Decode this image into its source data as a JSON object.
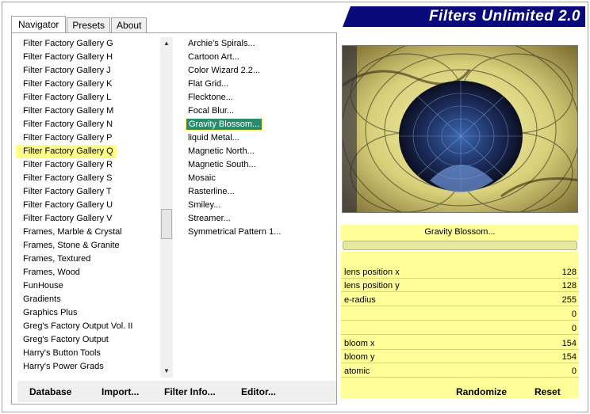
{
  "banner": {
    "title": "Filters Unlimited 2.0"
  },
  "tabs": [
    {
      "label": "Navigator"
    },
    {
      "label": "Presets"
    },
    {
      "label": "About"
    }
  ],
  "categories": {
    "items": [
      "Filter Factory Gallery G",
      "Filter Factory Gallery H",
      "Filter Factory Gallery J",
      "Filter Factory Gallery K",
      "Filter Factory Gallery L",
      "Filter Factory Gallery M",
      "Filter Factory Gallery N",
      "Filter Factory Gallery P",
      "Filter Factory Gallery Q",
      "Filter Factory Gallery R",
      "Filter Factory Gallery S",
      "Filter Factory Gallery T",
      "Filter Factory Gallery U",
      "Filter Factory Gallery V",
      "Frames, Marble & Crystal",
      "Frames, Stone & Granite",
      "Frames, Textured",
      "Frames, Wood",
      "FunHouse",
      "Gradients",
      "Graphics Plus",
      "Greg's Factory Output Vol. II",
      "Greg's Factory Output",
      "Harry's Button Tools",
      "Harry's Power Grads"
    ],
    "selected": "Filter Factory Gallery Q"
  },
  "filters": {
    "items": [
      "Archie's Spirals...",
      "Cartoon Art...",
      "Color Wizard 2.2...",
      "Flat Grid...",
      "Flecktone...",
      "Focal Blur...",
      "Gravity Blossom...",
      "liquid Metal...",
      "Magnetic North...",
      "Magnetic South...",
      "Mosaic",
      "Rasterline...",
      "Smiley...",
      "Streamer...",
      "Symmetrical Pattern 1..."
    ],
    "selected": "Gravity Blossom..."
  },
  "bottom_buttons": {
    "database": "Database",
    "import": "Import...",
    "filter_info": "Filter Info...",
    "editor": "Editor..."
  },
  "params": {
    "filter_name": "Gravity Blossom...",
    "sliders": [
      {
        "label": "lens position x",
        "value": "128"
      },
      {
        "label": "lens position y",
        "value": "128"
      },
      {
        "label": "e-radius",
        "value": "255"
      },
      {
        "label": "",
        "value": "0"
      },
      {
        "label": "",
        "value": "0"
      },
      {
        "label": "bloom x",
        "value": "154"
      },
      {
        "label": "bloom y",
        "value": "154"
      },
      {
        "label": "atomic",
        "value": "0"
      }
    ],
    "randomize": "Randomize",
    "reset": "Reset"
  },
  "colors": {
    "banner": "#0a0a7a",
    "param_bg": "#ffff99",
    "category_highlight": "#ffff88",
    "filter_highlight": "#2a8c6c"
  }
}
